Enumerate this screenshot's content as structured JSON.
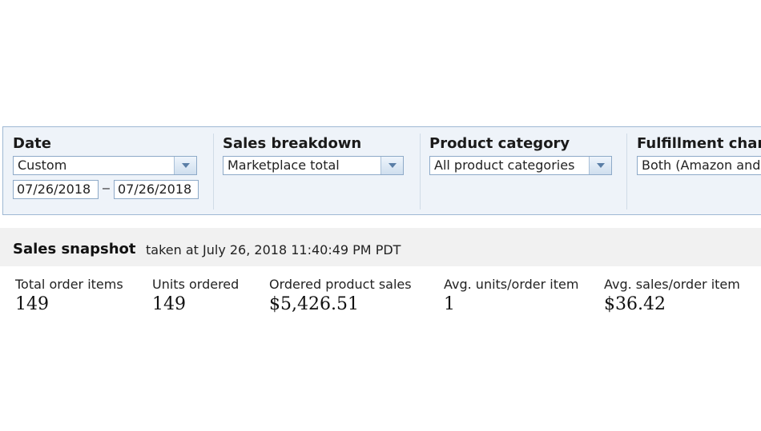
{
  "filters": {
    "date": {
      "label": "Date",
      "range_selected": "Custom",
      "start": "07/26/2018",
      "separator": "–",
      "end": "07/26/2018"
    },
    "sales_breakdown": {
      "label": "Sales breakdown",
      "selected": "Marketplace total"
    },
    "product_category": {
      "label": "Product category",
      "selected": "All product categories"
    },
    "fulfillment_channel": {
      "label": "Fulfillment chan",
      "selected": "Both (Amazon and"
    }
  },
  "snapshot": {
    "title": "Sales snapshot",
    "subtitle": "taken at July 26, 2018 11:40:49 PM PDT",
    "metrics": [
      {
        "label": "Total order items",
        "value": "149"
      },
      {
        "label": "Units ordered",
        "value": "149"
      },
      {
        "label": "Ordered product sales",
        "value": "$5,426.51"
      },
      {
        "label": "Avg. units/order item",
        "value": "1"
      },
      {
        "label": "Avg. sales/order item",
        "value": "$36.42"
      }
    ]
  },
  "icons": {
    "dropdown": "chevron-down-icon"
  },
  "colors": {
    "panel_bg": "#eef3f9",
    "panel_border": "#9fb9d4",
    "snapshot_bg": "#f1f1f1"
  }
}
